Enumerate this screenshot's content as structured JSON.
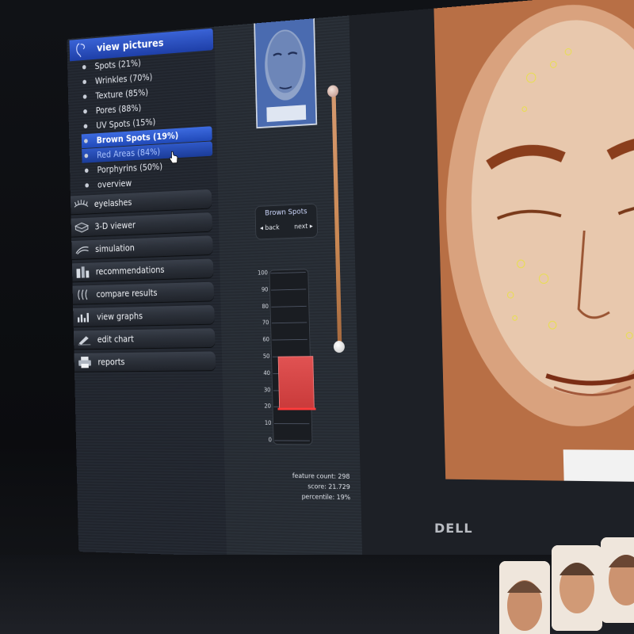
{
  "menu": {
    "header": "view pictures",
    "subitems": [
      {
        "label": "Spots (21%)"
      },
      {
        "label": "Wrinkles (70%)"
      },
      {
        "label": "Texture (85%)"
      },
      {
        "label": "Pores (88%)"
      },
      {
        "label": "UV Spots (15%)"
      },
      {
        "label": "Brown Spots (19%)"
      },
      {
        "label": "Red Areas (84%)"
      },
      {
        "label": "Porphyrins (50%)"
      },
      {
        "label": "overview"
      }
    ],
    "items": [
      {
        "label": "eyelashes",
        "icon": "eyelashes-icon"
      },
      {
        "label": "3-D viewer",
        "icon": "cube-icon"
      },
      {
        "label": "simulation",
        "icon": "simulation-icon"
      },
      {
        "label": "recommendations",
        "icon": "products-icon"
      },
      {
        "label": "compare results",
        "icon": "compare-icon"
      },
      {
        "label": "view graphs",
        "icon": "graph-icon"
      },
      {
        "label": "edit chart",
        "icon": "edit-icon"
      },
      {
        "label": "reports",
        "icon": "printer-icon"
      }
    ]
  },
  "viewer": {
    "title": "Brown Spots",
    "back_label": "back",
    "next_label": "next"
  },
  "gauge": {
    "ticks": [
      "100",
      "90",
      "80",
      "70",
      "60",
      "50",
      "40",
      "30",
      "20",
      "10",
      "0"
    ],
    "value_percent": 19
  },
  "stats": {
    "feature_count": "feature count: 298",
    "score": "score: 21.729",
    "percentile": "percentile: 19%"
  },
  "brand": "DELL",
  "colors": {
    "selected": "#3d6be0",
    "bar": "#e05252",
    "skin": "#c9865a"
  }
}
